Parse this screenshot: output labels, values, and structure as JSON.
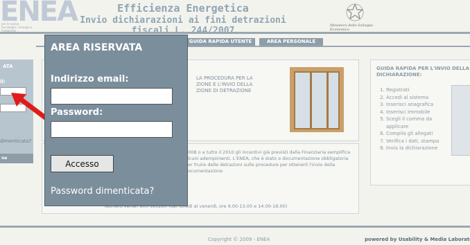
{
  "header": {
    "logo_text": "ENEA",
    "logo_subtitle": "per le nuove tecnologie, l'energia e l'ambiente",
    "title": "Efficienza Energetica",
    "subtitle": "Invio dichiarazioni ai fini detrazioni fiscali L. 244/2007",
    "emblem_caption": "Ministero dello Sviluppo Economico"
  },
  "nav": {
    "items": [
      {
        "label": "GUIDA RAPIDA UTENTE"
      },
      {
        "label": "AREA PERSONALE"
      }
    ]
  },
  "sidebar": {
    "title_fragment": "ATA",
    "field_fragment": "il:",
    "forgot_fragment": "dimenticata?",
    "tab_fragment": "ne"
  },
  "panel_a": {
    "text": "LA PROCEDURA PER LA ZIONE E L'INVIO DELLA ZIONE DI DETRAZIONE"
  },
  "panel_b": {
    "text": "2008 o a tutto il 2010 gli incentivi già previsti dalla Finanziaria semplifica alcuni adempimenti. L'ENEA, che è stato a documentazione obbligatoria per fruire delle detrazioni sulle procedure per ottenerli l'invio della documentazione",
    "footer": "Numero verde: 800 983280 (dal lunedì al venerdì, ore 9.00-13.00 e 14.00-18.00)"
  },
  "guide": {
    "heading": "GUIDA RAPIDA PER L'INVIO DELLA DICHIARAZIONE:",
    "steps": [
      {
        "label": "Registrati"
      },
      {
        "label": "Accedi al sistema"
      },
      {
        "label": "Inserisci anagrafica"
      },
      {
        "label": "Inserisci immobile"
      },
      {
        "label": "Scegli il comma da applicare"
      },
      {
        "label": "Compila gli allegati"
      },
      {
        "label": "Verifica i dati, stampa"
      },
      {
        "label": "Invia la dichiarazione"
      }
    ]
  },
  "footer": {
    "copyright": "Copyright © 2009 - ENEA",
    "powered": "powered by Usability & Media Laboratory - E"
  },
  "login": {
    "title": "AREA RISERVATA",
    "email_label": "Indirizzo email:",
    "email_value": "",
    "password_label": "Password:",
    "password_value": "",
    "submit_label": "Accesso",
    "forgot_label": "Password dimenticata?"
  },
  "colors": {
    "popup_bg": "#7b8e9c",
    "nav_bg": "#8e9ea9",
    "arrow": "#e11a1a"
  }
}
